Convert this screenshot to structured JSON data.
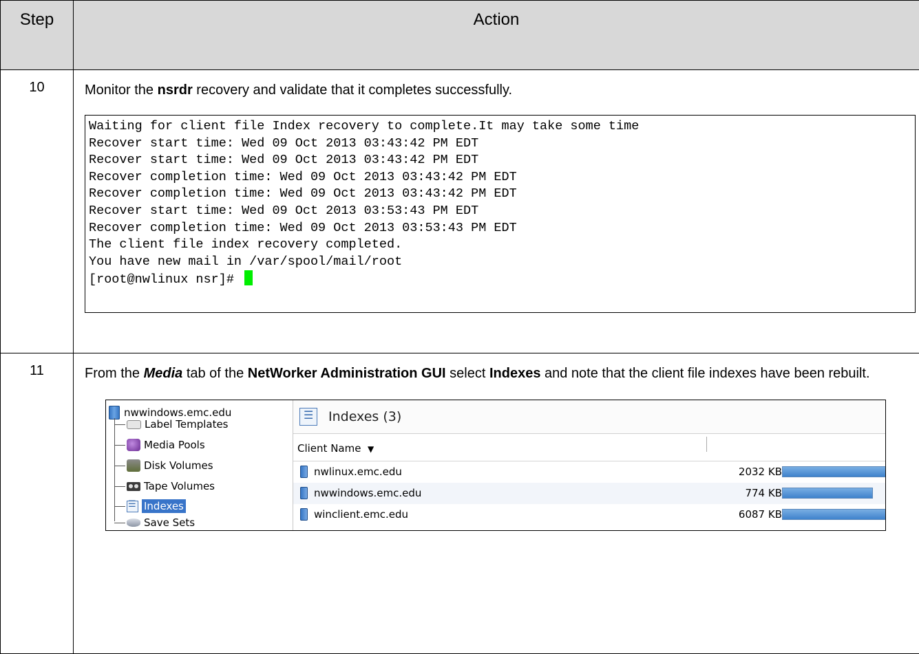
{
  "table": {
    "header_step": "Step",
    "header_action": "Action"
  },
  "step10": {
    "number": "10",
    "text_before": "Monitor the ",
    "text_bold": "nsrdr",
    "text_after": " recovery and validate that it completes successfully.",
    "terminal_lines": [
      "Waiting for client file Index recovery to complete.It may take some time",
      "Recover start time: Wed 09 Oct 2013 03:43:42 PM EDT",
      "Recover start time: Wed 09 Oct 2013 03:43:42 PM EDT",
      "Recover completion time: Wed 09 Oct 2013 03:43:42 PM EDT",
      "Recover completion time: Wed 09 Oct 2013 03:43:42 PM EDT",
      "Recover start time: Wed 09 Oct 2013 03:53:43 PM EDT",
      "Recover completion time: Wed 09 Oct 2013 03:53:43 PM EDT",
      "The client file index recovery completed.",
      "You have new mail in /var/spool/mail/root",
      "[root@nwlinux nsr]# "
    ],
    "cursor_color": "#00ee00"
  },
  "step11": {
    "number": "11",
    "t1": "From the ",
    "t2": "Media",
    "t3": " tab of the ",
    "t4": "NetWorker Administration GUI",
    "t5": " select ",
    "t6": "Indexes",
    "t7": " and note that the client file indexes have been rebuilt.",
    "gui": {
      "tree_root": "nwwindows.emc.edu",
      "tree_items": [
        {
          "label": "Label Templates",
          "icon": "label-icon"
        },
        {
          "label": "Media Pools",
          "icon": "pool-icon"
        },
        {
          "label": "Disk Volumes",
          "icon": "disk-icon"
        },
        {
          "label": "Tape Volumes",
          "icon": "tape-icon"
        },
        {
          "label": "Indexes",
          "icon": "index-icon",
          "selected": true
        },
        {
          "label": "Save Sets",
          "icon": "saveset-icon"
        }
      ],
      "panel_title": "Indexes (3)",
      "column_client": "Client Name",
      "sort_indicator": "▼",
      "rows": [
        {
          "name": "nwlinux.emc.edu",
          "size": "2032 KB",
          "usage": 2032
        },
        {
          "name": "nwwindows.emc.edu",
          "size": "774 KB",
          "usage": 774
        },
        {
          "name": "winclient.emc.edu",
          "size": "6087 KB",
          "usage": 6087
        }
      ],
      "selection_color": "#3874c9"
    }
  }
}
